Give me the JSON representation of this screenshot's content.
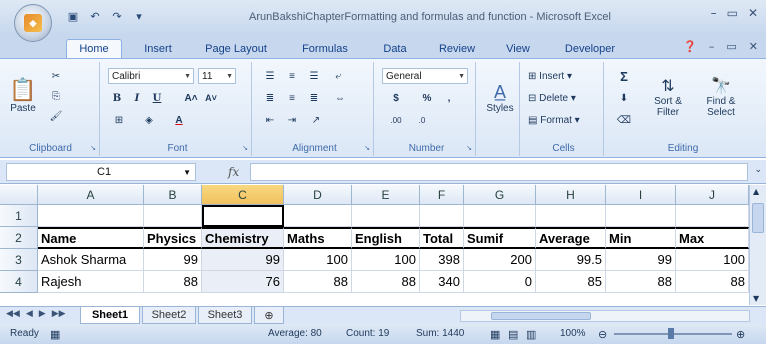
{
  "window": {
    "title": "ArunBakshiChapterFormatting and formulas and function - Microsoft Excel",
    "office_button_icon": "office-logo-icon",
    "qat": [
      "save-icon",
      "undo-icon",
      "redo-icon",
      "customize-icon"
    ],
    "controls": [
      "minimize-icon",
      "restore-icon",
      "close-icon"
    ]
  },
  "tabs": [
    {
      "label": "Home",
      "active": true
    },
    {
      "label": "Insert"
    },
    {
      "label": "Page Layout"
    },
    {
      "label": "Formulas"
    },
    {
      "label": "Data"
    },
    {
      "label": "Review"
    },
    {
      "label": "View"
    },
    {
      "label": "Developer"
    }
  ],
  "ribbon": {
    "clipboard": {
      "label": "Clipboard",
      "paste": "Paste"
    },
    "font": {
      "label": "Font",
      "name": "Calibri",
      "size": "11",
      "bold": "B",
      "italic": "I",
      "underline": "U"
    },
    "alignment": {
      "label": "Alignment"
    },
    "number": {
      "label": "Number",
      "format": "General",
      "currency": "$",
      "percent": "%",
      "comma": ",",
      "inc": ".00",
      "dec": ".0"
    },
    "styles": {
      "label": "Styles"
    },
    "cells": {
      "label": "Cells",
      "insert": "Insert",
      "delete": "Delete",
      "format": "Format"
    },
    "editing": {
      "label": "Editing",
      "sort": "Sort &",
      "sort2": "Filter",
      "find": "Find &",
      "find2": "Select",
      "sigma": "Σ"
    }
  },
  "formula_bar": {
    "name_box": "C1",
    "fx": "fx",
    "value": ""
  },
  "grid": {
    "columns": [
      "A",
      "B",
      "C",
      "D",
      "E",
      "F",
      "G",
      "H",
      "I",
      "J"
    ],
    "rows": [
      {
        "num": "1",
        "cells": [
          "",
          "",
          "",
          "",
          "",
          "",
          "",
          "",
          "",
          ""
        ]
      },
      {
        "num": "2",
        "cells": [
          "Name",
          "Physics",
          "Chemistry",
          "Maths",
          "English",
          "Total",
          "Sumif",
          "Average",
          "Min",
          "Max"
        ]
      },
      {
        "num": "3",
        "cells": [
          "Ashok Sharma",
          "99",
          "99",
          "100",
          "100",
          "398",
          "200",
          "99.5",
          "99",
          "100"
        ]
      },
      {
        "num": "4",
        "cells": [
          "Rajesh",
          "88",
          "76",
          "88",
          "88",
          "340",
          "0",
          "85",
          "88",
          "88"
        ]
      }
    ]
  },
  "sheets": [
    {
      "label": "Sheet1",
      "active": true
    },
    {
      "label": "Sheet2"
    },
    {
      "label": "Sheet3"
    }
  ],
  "status": {
    "ready": "Ready",
    "average": "Average: 80",
    "count": "Count: 19",
    "sum": "Sum: 1440",
    "zoom": "100%"
  }
}
